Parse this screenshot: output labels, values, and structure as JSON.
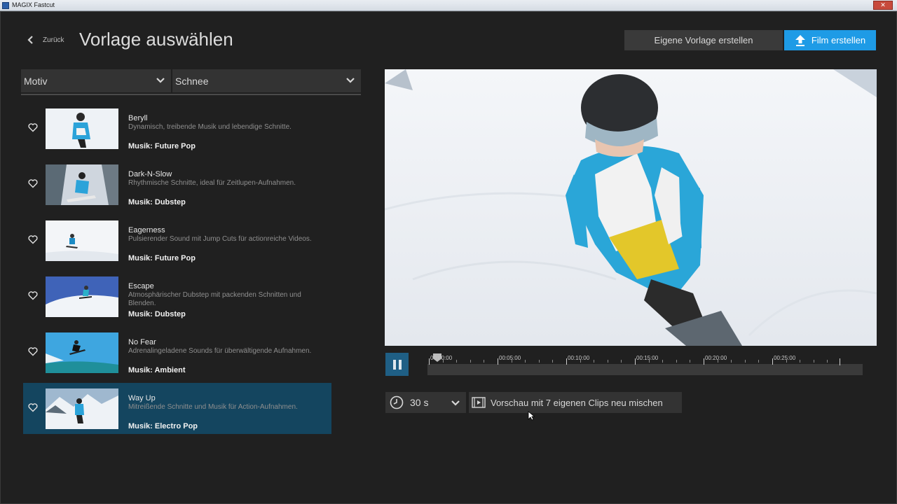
{
  "window": {
    "title": "MAGIX Fastcut"
  },
  "header": {
    "back_label": "Zurück",
    "title": "Vorlage auswählen",
    "own_template_button": "Eigene Vorlage erstellen",
    "create_film_button": "Film erstellen"
  },
  "filters": {
    "category": "Motiv",
    "value": "Schnee"
  },
  "templates": [
    {
      "name": "Beryll",
      "description": "Dynamisch, treibende Musik und lebendige Schnitte.",
      "music": "Musik: Future Pop",
      "selected": false
    },
    {
      "name": "Dark-N-Slow",
      "description": "Rhythmische Schnitte, ideal für Zeitlupen-Aufnahmen.",
      "music": "Musik: Dubstep",
      "selected": false
    },
    {
      "name": "Eagerness",
      "description": "Pulsierender Sound mit Jump Cuts für actionreiche Videos.",
      "music": "Musik: Future Pop",
      "selected": false
    },
    {
      "name": "Escape",
      "description": "Atmosphärischer Dubstep mit packenden Schnitten und Blenden.",
      "music": "Musik: Dubstep",
      "selected": false
    },
    {
      "name": "No Fear",
      "description": "Adrenalingeladene Sounds für überwältigende Aufnahmen.",
      "music": "Musik: Ambient",
      "selected": false
    },
    {
      "name": "Way Up",
      "description": "Mitreißende Schnitte und Musik für Action-Aufnahmen.",
      "music": "Musik: Electro Pop",
      "selected": true
    }
  ],
  "timeline": {
    "labels": [
      "00:00:00",
      "00:05:00",
      "00:10:00",
      "00:15:00",
      "00:20:00",
      "00:25:00"
    ],
    "playhead_seconds": 0,
    "state": "playing"
  },
  "controls": {
    "duration": "30 s",
    "remix_label": "Vorschau mit 7 eigenen Clips neu mischen"
  },
  "colors": {
    "accent": "#1e9be6",
    "selected_row": "#14455f",
    "play_button": "#1f5f85"
  }
}
